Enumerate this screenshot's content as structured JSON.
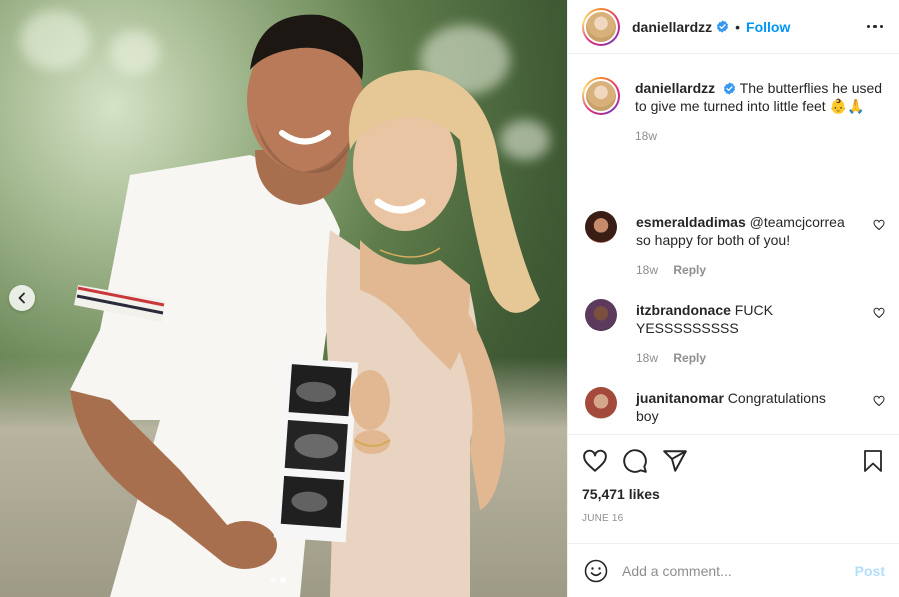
{
  "post": {
    "author": "daniellardzz",
    "verified": true,
    "follow_label": "Follow",
    "separator": "•",
    "carousel": {
      "slides": 2,
      "active_slide": 2
    }
  },
  "caption": {
    "username": "daniellardzz",
    "text": "The butterflies he used to give me turned into little feet 👶🙏",
    "age": "18w"
  },
  "comments": [
    {
      "username": "esmeraldadimas",
      "text": "@teamcjcorrea so happy for both of you!",
      "age": "18w",
      "reply_label": "Reply"
    },
    {
      "username": "itzbrandonace",
      "text": "FUCK YESSSSSSSSS",
      "age": "18w",
      "reply_label": "Reply"
    },
    {
      "username": "juanitanomar",
      "text": "Congratulations boy"
    }
  ],
  "stats": {
    "likes": "75,471 likes",
    "date": "JUNE 16"
  },
  "add_comment": {
    "placeholder": "Add a comment...",
    "post_label": "Post"
  },
  "colors": {
    "link": "#0095f6",
    "text": "#262626",
    "muted": "#8e8e8e",
    "post_disabled": "#b2dffc",
    "verified": "#3897f0"
  },
  "icons": [
    "chevron-left-icon",
    "verified-badge-icon",
    "more-icon",
    "heart-icon",
    "comment-icon",
    "share-icon",
    "bookmark-icon",
    "emoji-icon"
  ]
}
